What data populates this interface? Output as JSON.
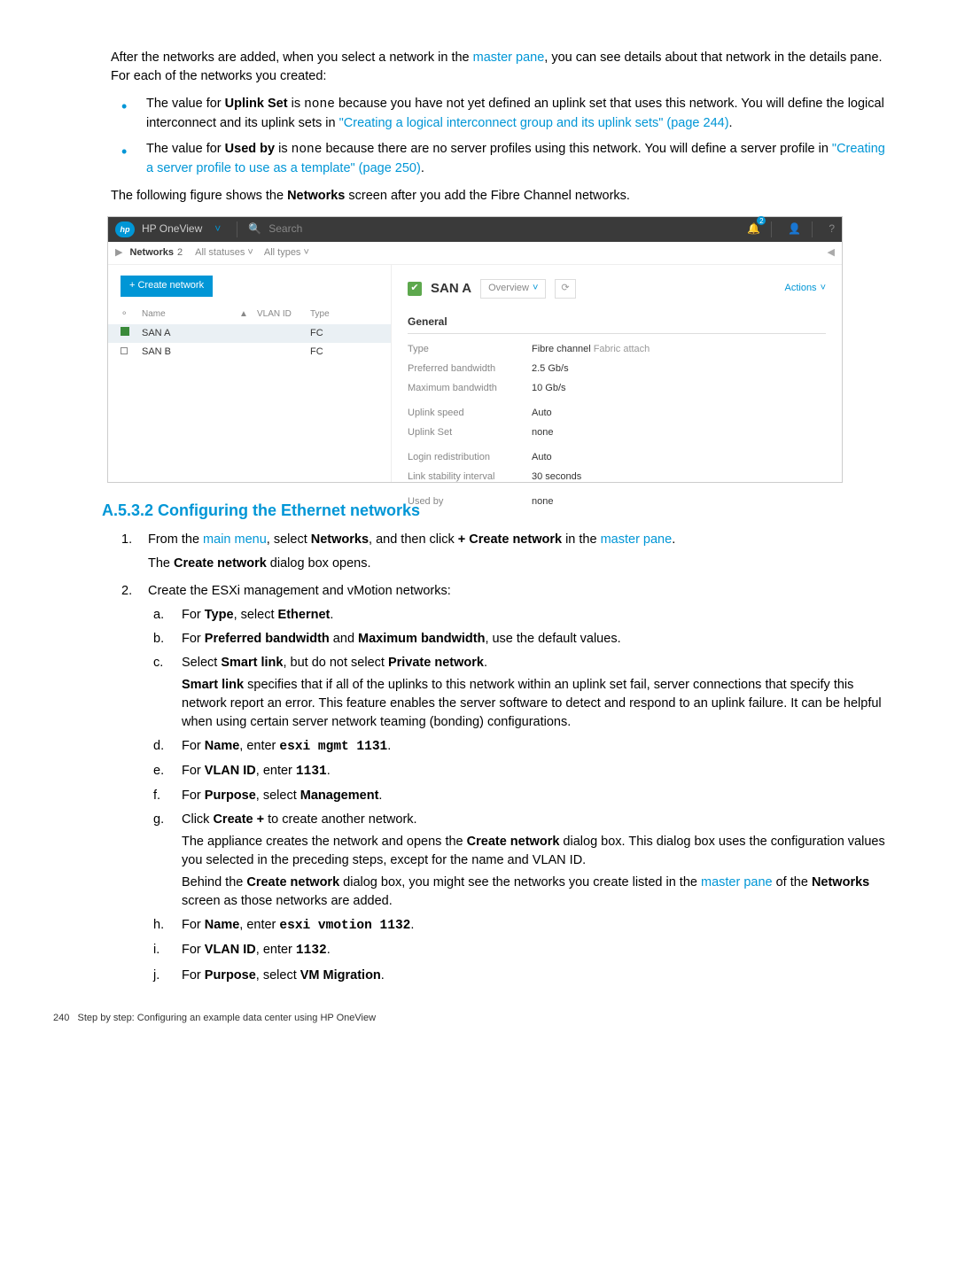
{
  "intro": {
    "p1a": "After the networks are added, when you select a network in the ",
    "p1link": "master pane",
    "p1b": ", you can see details about that network in the details pane. For each of the networks you created:",
    "b1a": "The value for ",
    "b1bold1": "Uplink Set",
    "b1b": " is ",
    "b1mono": "none",
    "b1c": " because you have not yet defined an uplink set that uses this network. You will define the logical interconnect and its uplink sets in ",
    "b1link": "\"Creating a logical interconnect group and its uplink sets\" (page 244)",
    "b1d": ".",
    "b2a": "The value for ",
    "b2bold1": "Used by",
    "b2b": " is ",
    "b2mono": "none",
    "b2c": " because there are no server profiles using this network. You will define a server profile in ",
    "b2link": "\"Creating a server profile to use as a template\" (page 250)",
    "b2d": ".",
    "p2a": "The following figure shows the ",
    "p2bold": "Networks",
    "p2b": " screen after you add the Fibre Channel networks."
  },
  "ss": {
    "top": {
      "brand": "hp",
      "product": "HP OneView",
      "search": "Search",
      "notif": "2"
    },
    "bread": {
      "title": "Networks",
      "count": "2",
      "f1": "All statuses",
      "f2": "All types"
    },
    "create": "+ Create network",
    "th": {
      "name": "Name",
      "vlan": "VLAN ID",
      "type": "Type"
    },
    "rows": [
      {
        "name": "SAN A",
        "vlan": "",
        "type": "FC",
        "sel": true
      },
      {
        "name": "SAN B",
        "vlan": "",
        "type": "FC",
        "sel": false
      }
    ],
    "det": {
      "title": "SAN A",
      "view": "Overview",
      "actions": "Actions",
      "general": "General",
      "r1l": "Type",
      "r1v": "Fibre channel",
      "r1v2": " Fabric attach",
      "r2l": "Preferred bandwidth",
      "r2v": "2.5 Gb/s",
      "r3l": "Maximum bandwidth",
      "r3v": "10 Gb/s",
      "r4l": "Uplink speed",
      "r4v": "Auto",
      "r5l": "Uplink Set",
      "r5v": "none",
      "r6l": "Login redistribution",
      "r6v": "Auto",
      "r7l": "Link stability interval",
      "r7v": "30 seconds",
      "r8l": "Used by",
      "r8v": "none"
    }
  },
  "sec": {
    "heading": "A.5.3.2 Configuring the Ethernet networks",
    "s1": {
      "num": "1.",
      "a1": "From the ",
      "link1": "main menu",
      "a2": ", select ",
      "bold1": "Networks",
      "a3": ", and then click ",
      "bold2": "+ Create network",
      "a4": " in the ",
      "link2": "master pane",
      "a5": ".",
      "p2a": "The ",
      "p2bold": "Create network",
      "p2b": " dialog box opens."
    },
    "s2": {
      "num": "2.",
      "p1": "Create the ESXi management and vMotion networks:",
      "a": {
        "let": "a.",
        "t1": "For ",
        "b1": "Type",
        "t2": ", select ",
        "b2": "Ethernet",
        "t3": "."
      },
      "b": {
        "let": "b.",
        "t1": "For ",
        "b1": "Preferred bandwidth",
        "t2": " and ",
        "b2": "Maximum bandwidth",
        "t3": ", use the default values."
      },
      "c": {
        "let": "c.",
        "t1": "Select ",
        "b1": "Smart link",
        "t2": ", but do not select ",
        "b2": "Private network",
        "t3": ".",
        "sub1a": "",
        "sub1bold": "Smart link",
        "sub1b": " specifies that if all of the uplinks to this network within an uplink set fail, server connections that specify this network report an error. This feature enables the server software to detect and respond to an uplink failure. It can be helpful when using certain server network teaming (bonding) configurations."
      },
      "d": {
        "let": "d.",
        "t1": "For ",
        "b1": "Name",
        "t2": ", enter ",
        "m1": "esxi mgmt 1131",
        "t3": "."
      },
      "e": {
        "let": "e.",
        "t1": "For ",
        "b1": "VLAN ID",
        "t2": ", enter ",
        "m1": "1131",
        "t3": "."
      },
      "f": {
        "let": "f.",
        "t1": "For ",
        "b1": "Purpose",
        "t2": ", select ",
        "b2": "Management",
        "t3": "."
      },
      "g": {
        "let": "g.",
        "t1": "Click ",
        "b1": "Create +",
        "t2": " to create another network.",
        "sub1a": "The appliance creates the network and opens the ",
        "sub1bold": "Create network",
        "sub1b": " dialog box. This dialog box uses the configuration values you selected in the preceding steps, except for the name and VLAN ID.",
        "sub2a": "Behind the ",
        "sub2bold": "Create network",
        "sub2b": " dialog box, you might see the networks you create listed in the ",
        "sub2link": "master pane",
        "sub2c": " of the ",
        "sub2bold2": "Networks",
        "sub2d": " screen as those networks are added."
      },
      "h": {
        "let": "h.",
        "t1": "For ",
        "b1": "Name",
        "t2": ", enter ",
        "m1": "esxi vmotion 1132",
        "t3": "."
      },
      "i": {
        "let": "i.",
        "t1": "For ",
        "b1": "VLAN ID",
        "t2": ", enter ",
        "m1": "1132",
        "t3": "."
      },
      "j": {
        "let": "j.",
        "t1": "For ",
        "b1": "Purpose",
        "t2": ", select ",
        "b2": "VM Migration",
        "t3": "."
      }
    }
  },
  "footer": {
    "page": "240",
    "text": "Step by step: Configuring an example data center using HP OneView"
  }
}
